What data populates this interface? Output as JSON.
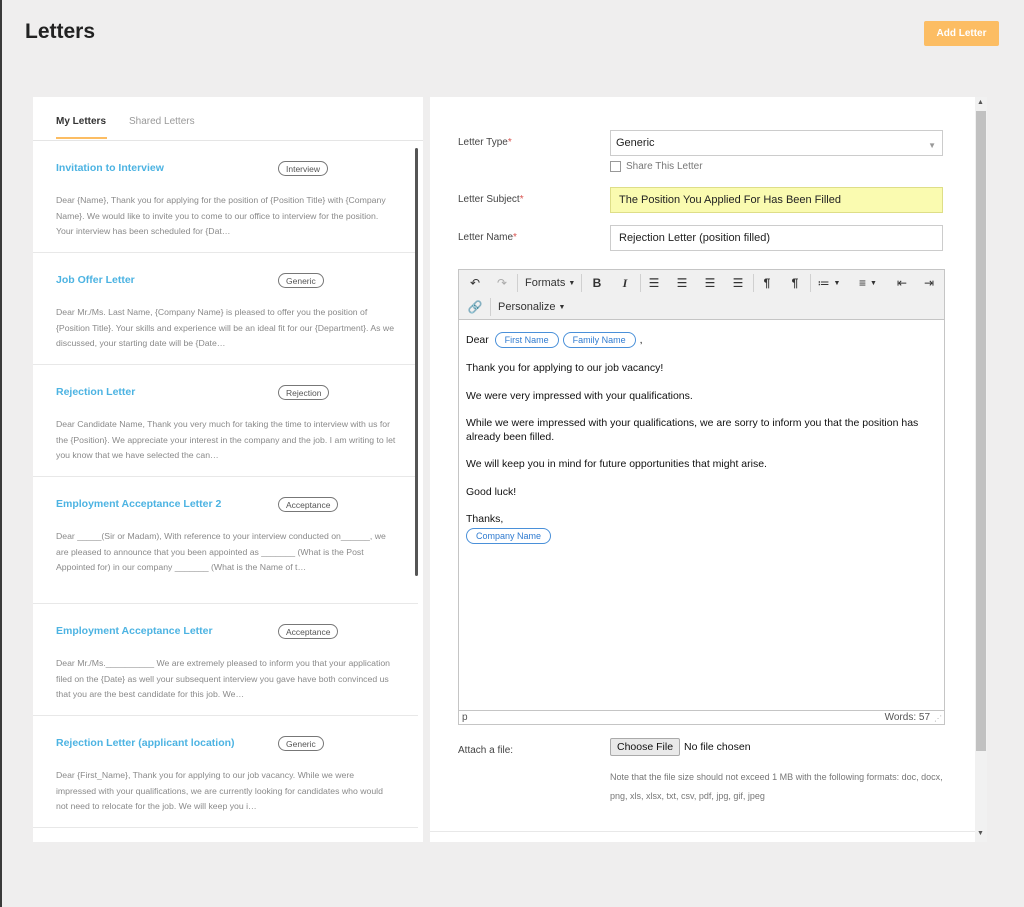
{
  "header": {
    "title": "Letters",
    "add_button": "Add Letter"
  },
  "tabs": {
    "my_letters": "My Letters",
    "shared_letters": "Shared Letters"
  },
  "letters": [
    {
      "title": "Invitation to Interview",
      "badge": "Interview",
      "preview": "Dear {Name}, Thank you for applying for the position of {Position Title} with {Company Name}. We would like to invite you to come to our office to interview for the position. Your interview has been scheduled for {Dat…"
    },
    {
      "title": "Job Offer Letter",
      "badge": "Generic",
      "preview": "Dear Mr./Ms. Last Name, {Company Name} is pleased to offer you the position of {Position Title}. Your skills and experience will be an ideal fit for our {Department}. As we discussed, your starting date will be {Date…"
    },
    {
      "title": "Rejection Letter",
      "badge": "Rejection",
      "preview": "Dear Candidate Name, Thank you very much for taking the time to interview with us for the {Position}. We appreciate your interest in the company and the job. I am writing to let you know that we have selected the can…"
    },
    {
      "title": "Employment Acceptance Letter 2",
      "badge": "Acceptance",
      "preview": "Dear _____(Sir or Madam), With reference to your interview conducted on______, we are pleased to announce that you been appointed as _______ (What is the Post Appointed for) in our company _______ (What is the Name of t…"
    },
    {
      "title": "Employment Acceptance Letter",
      "badge": "Acceptance",
      "preview": "Dear Mr./Ms.__________ We are extremely pleased to inform you that your application filed on the {Date} as well your subsequent interview you gave have both convinced us that you are the best candidate for this job. We…"
    },
    {
      "title": "Rejection Letter (applicant location)",
      "badge": "Generic",
      "preview": "Dear {First_Name}, Thank you for applying to our job vacancy. While we were impressed with your qualifications, we are currently looking for candidates who would not need to relocate for the job. We will keep you i…"
    }
  ],
  "form": {
    "letter_type_label": "Letter Type",
    "letter_type_value": "Generic",
    "share_label": "Share This Letter",
    "subject_label": "Letter Subject",
    "subject_value": "The Position You Applied For Has Been Filled",
    "name_label": "Letter Name",
    "name_value": "Rejection Letter (position filled)",
    "required_mark": "*",
    "attach_label": "Attach a file:",
    "choose_file": "Choose File",
    "no_file": "No file chosen",
    "file_note": "Note that the file size should not exceed 1 MB with the following formats: doc, docx, png, xls, xlsx, txt, csv, pdf, jpg, gif, jpeg"
  },
  "editor": {
    "formats_label": "Formats",
    "personalize_label": "Personalize",
    "dear": "Dear",
    "chip_first_name": "First Name",
    "chip_family_name": "Family Name",
    "comma": ",",
    "para1": "Thank you for applying to our job vacancy!",
    "para2": "We were very impressed with your qualifications.",
    "para3": "While we were impressed with your qualifications, we are sorry to inform you that the position has already been filled.",
    "para4": "We will keep you in mind for future opportunities that might arise.",
    "para5": "Good luck!",
    "thanks": "Thanks,",
    "chip_company_name": "Company Name",
    "status_path": "p",
    "word_count": "Words: 57"
  },
  "colors": {
    "accent": "#fcbd63",
    "link": "#4cb3e2",
    "chip": "#4a90d9",
    "subject_highlight": "#fafbb0"
  },
  "icons": [
    "undo-icon",
    "redo-icon",
    "bold-icon",
    "italic-icon",
    "align-left-icon",
    "align-center-icon",
    "align-right-icon",
    "align-justify-icon",
    "ltr-icon",
    "rtl-icon",
    "bullet-list-icon",
    "numbered-list-icon",
    "outdent-icon",
    "indent-icon",
    "link-icon",
    "chevron-down-icon"
  ]
}
